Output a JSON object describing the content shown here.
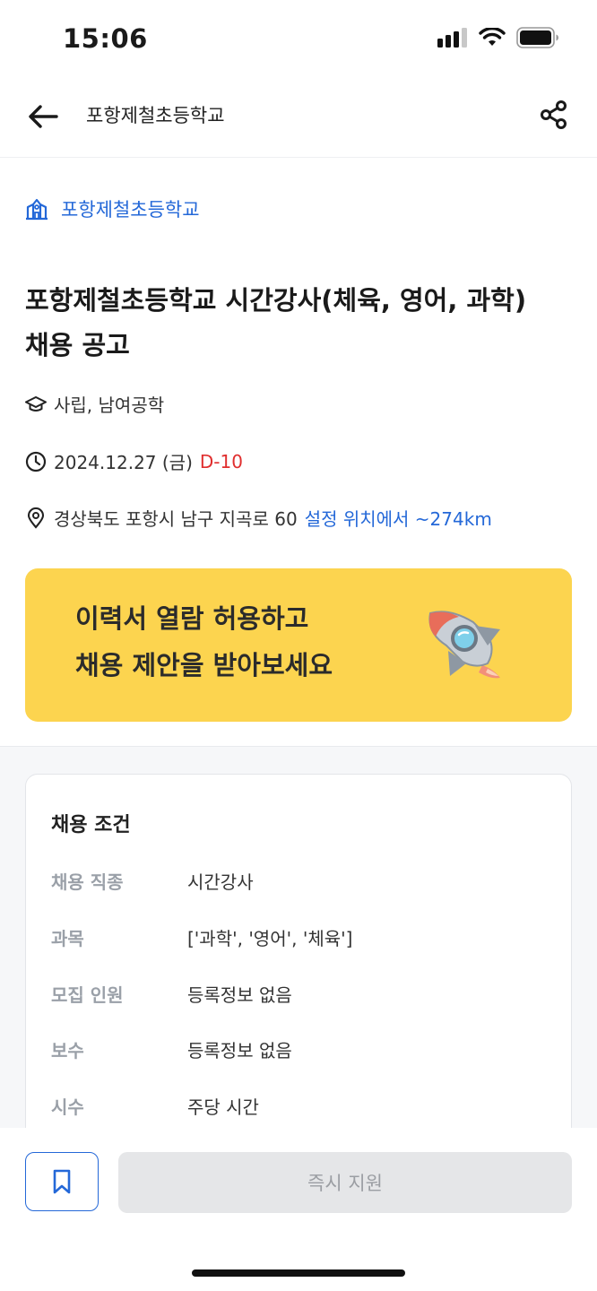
{
  "status_bar": {
    "time": "15:06"
  },
  "header": {
    "title": "포항제철초등학교",
    "back_icon": "arrow-left-icon",
    "share_icon": "share-icon"
  },
  "school": {
    "name": "포항제철초등학교",
    "icon": "school-building-icon"
  },
  "job": {
    "title_line1": "포항제철초등학교 시간강사(체육, 영어, 과학)",
    "title_line2": "채용 공고",
    "school_type": "사립, 남여공학",
    "deadline_date": "2024.12.27 (금)",
    "dday": "D-10",
    "address": "경상북도 포항시 남구 지곡로 60",
    "distance": "설정 위치에서 ~274km"
  },
  "banner": {
    "line1": "이력서 열람 허용하고",
    "line2": "채용 제안을 받아보세요"
  },
  "conditions": {
    "title": "채용 조건",
    "rows": [
      {
        "label": "채용 직종",
        "value": "시간강사"
      },
      {
        "label": "과목",
        "value": "['과학', '영어', '체육']"
      },
      {
        "label": "모집 인원",
        "value": "등록정보 없음"
      },
      {
        "label": "보수",
        "value": "등록정보 없음"
      },
      {
        "label": "시수",
        "value": "주당 시간"
      }
    ]
  },
  "bottom": {
    "apply_label": "즉시 지원"
  },
  "colors": {
    "accent_blue": "#2468d8",
    "dday_red": "#e02e2e",
    "banner_yellow": "#fcd44f"
  }
}
